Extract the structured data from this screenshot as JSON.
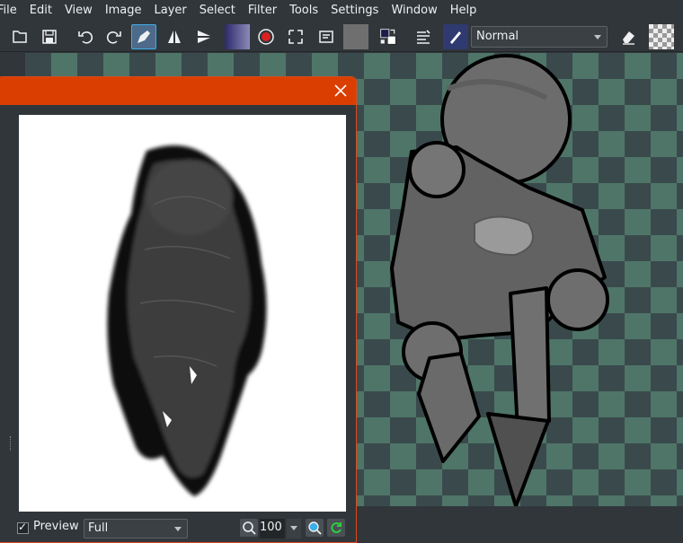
{
  "menubar": {
    "items": [
      "File",
      "Edit",
      "View",
      "Image",
      "Layer",
      "Select",
      "Filter",
      "Tools",
      "Settings",
      "Window",
      "Help"
    ]
  },
  "toolbar": {
    "icons": [
      "new-document-icon",
      "save-icon",
      "undo-icon",
      "redo-icon",
      "brush-preset-icon",
      "mirror-horizontal-icon",
      "mirror-vertical-icon",
      "gradient-icon",
      "record-icon",
      "transform-icon",
      "layer-properties-icon",
      "pattern-icon",
      "color-swap-icon",
      "brush-settings-icon",
      "brush-tip-icon",
      "eraser-icon",
      "transparency-icon"
    ],
    "blend_mode": "Normal"
  },
  "dialog": {
    "accent_color": "#da3e00",
    "preview_label": "Preview",
    "resolution_value": "Full",
    "zoom_value": "100 %"
  },
  "colors": {
    "background": "#31363b",
    "checker_dark": "#3a4a4c",
    "checker_light": "#4f7568",
    "selection": "#3daee9"
  }
}
